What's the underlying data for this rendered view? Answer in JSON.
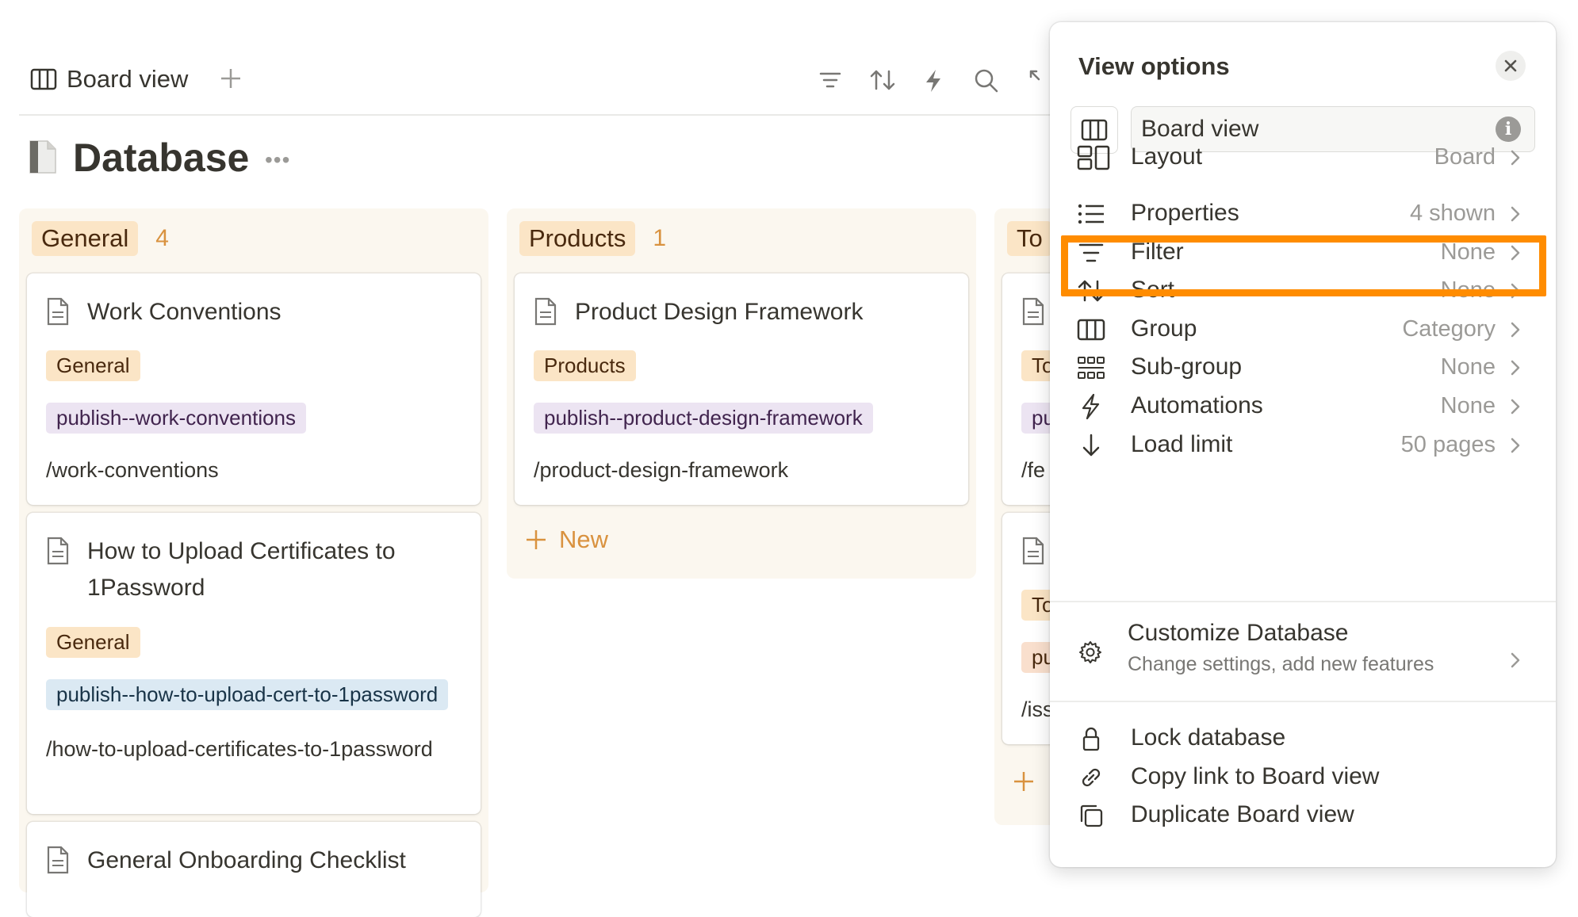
{
  "toolbar": {
    "view_tab_label": "Board view",
    "add_view_icon": "plus-icon",
    "icons": [
      "filter-icon",
      "sort-icon",
      "lightning-icon",
      "search-icon",
      "expand-icon"
    ]
  },
  "page": {
    "title": "Database",
    "more": "•••"
  },
  "columns": [
    {
      "name": "General",
      "count": "4",
      "cards": [
        {
          "title": "Work Conventions",
          "category": "General",
          "publish": "publish--work-conventions",
          "path": "/work-conventions"
        },
        {
          "title": "How to Upload Certificates to 1Password",
          "category": "General",
          "publish": "publish--how-to-upload-cert-to-1password",
          "path": "/how-to-upload-certificates-to-1password"
        },
        {
          "title": "General Onboarding Checklist"
        }
      ]
    },
    {
      "name": "Products",
      "count": "1",
      "cards": [
        {
          "title": "Product Design Framework",
          "category": "Products",
          "publish": "publish--product-design-framework",
          "path": "/product-design-framework"
        }
      ],
      "new_label": "New"
    },
    {
      "name": "To",
      "cards": [
        {
          "category": "To",
          "publish": "pu",
          "path": "/fe"
        },
        {
          "category": "To",
          "publish": "pu",
          "path": "/iss"
        }
      ]
    }
  ],
  "view_options": {
    "title": "View options",
    "name_value": "Board view",
    "rows": [
      {
        "label": "Layout",
        "value": "Board",
        "icon": "layout-icon"
      },
      {
        "label": "Properties",
        "value": "4 shown",
        "icon": "list-icon"
      },
      {
        "label": "Filter",
        "value": "None",
        "icon": "filter-icon"
      },
      {
        "label": "Sort",
        "value": "None",
        "icon": "sort-icon"
      },
      {
        "label": "Group",
        "value": "Category",
        "icon": "columns-icon"
      },
      {
        "label": "Sub-group",
        "value": "None",
        "icon": "grid-icon"
      },
      {
        "label": "Automations",
        "value": "None",
        "icon": "lightning-icon"
      },
      {
        "label": "Load limit",
        "value": "50 pages",
        "icon": "arrow-down-icon"
      }
    ],
    "customize": {
      "title": "Customize Database",
      "subtitle": "Change settings, add new features"
    },
    "actions": [
      {
        "label": "Lock database",
        "icon": "lock-icon"
      },
      {
        "label": "Copy link to Board view",
        "icon": "link-icon"
      },
      {
        "label": "Duplicate Board view",
        "icon": "duplicate-icon"
      }
    ]
  },
  "colors": {
    "highlight": "#ff8c00",
    "accent": "#d9923f",
    "tag_yellow": "#fbe5c6",
    "tag_purple": "#ece4f2",
    "tag_blue": "#dbe9f3"
  }
}
